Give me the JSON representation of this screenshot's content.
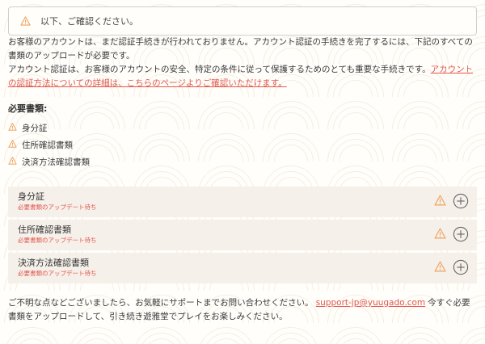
{
  "alert": {
    "text": "以下、ご確認ください。",
    "icon": "warning-icon"
  },
  "intro": {
    "paragraph1": "お客様のアカウントは、まだ認証手続きが行われておりません。アカウント認証の手続きを完了するには、下記のすべての書類のアップロードが必要です。",
    "paragraph2_text": "アカウント認証は、お客様のアカウントの安全、特定の条件に従って保護するためのとても重要な手続きです。",
    "paragraph2_link": "アカウントの認証方法についての詳細は、こちらのページよりご確認いただけます。"
  },
  "required": {
    "heading": "必要書類:",
    "items": [
      "身分証",
      "住所確認書類",
      "決済方法確認書類"
    ]
  },
  "documents": [
    {
      "title": "身分証",
      "status": "必要書類のアップデート待ち"
    },
    {
      "title": "住所確認書類",
      "status": "必要書類のアップデート待ち"
    },
    {
      "title": "決済方法確認書類",
      "status": "必要書類のアップデート待ち"
    }
  ],
  "footer": {
    "text_before": "ご不明な点などございましたら、お気軽にサポートまでお問い合わせください。",
    "email": "support-jp@yuugado.com",
    "text_after": "今すぐ必要書類をアップロードして、引き続き遊雅堂でプレイをお楽しみください。"
  },
  "colors": {
    "accent": "#e2574c",
    "warning": "#f0a35e",
    "row_background": "#f5f0ea"
  }
}
